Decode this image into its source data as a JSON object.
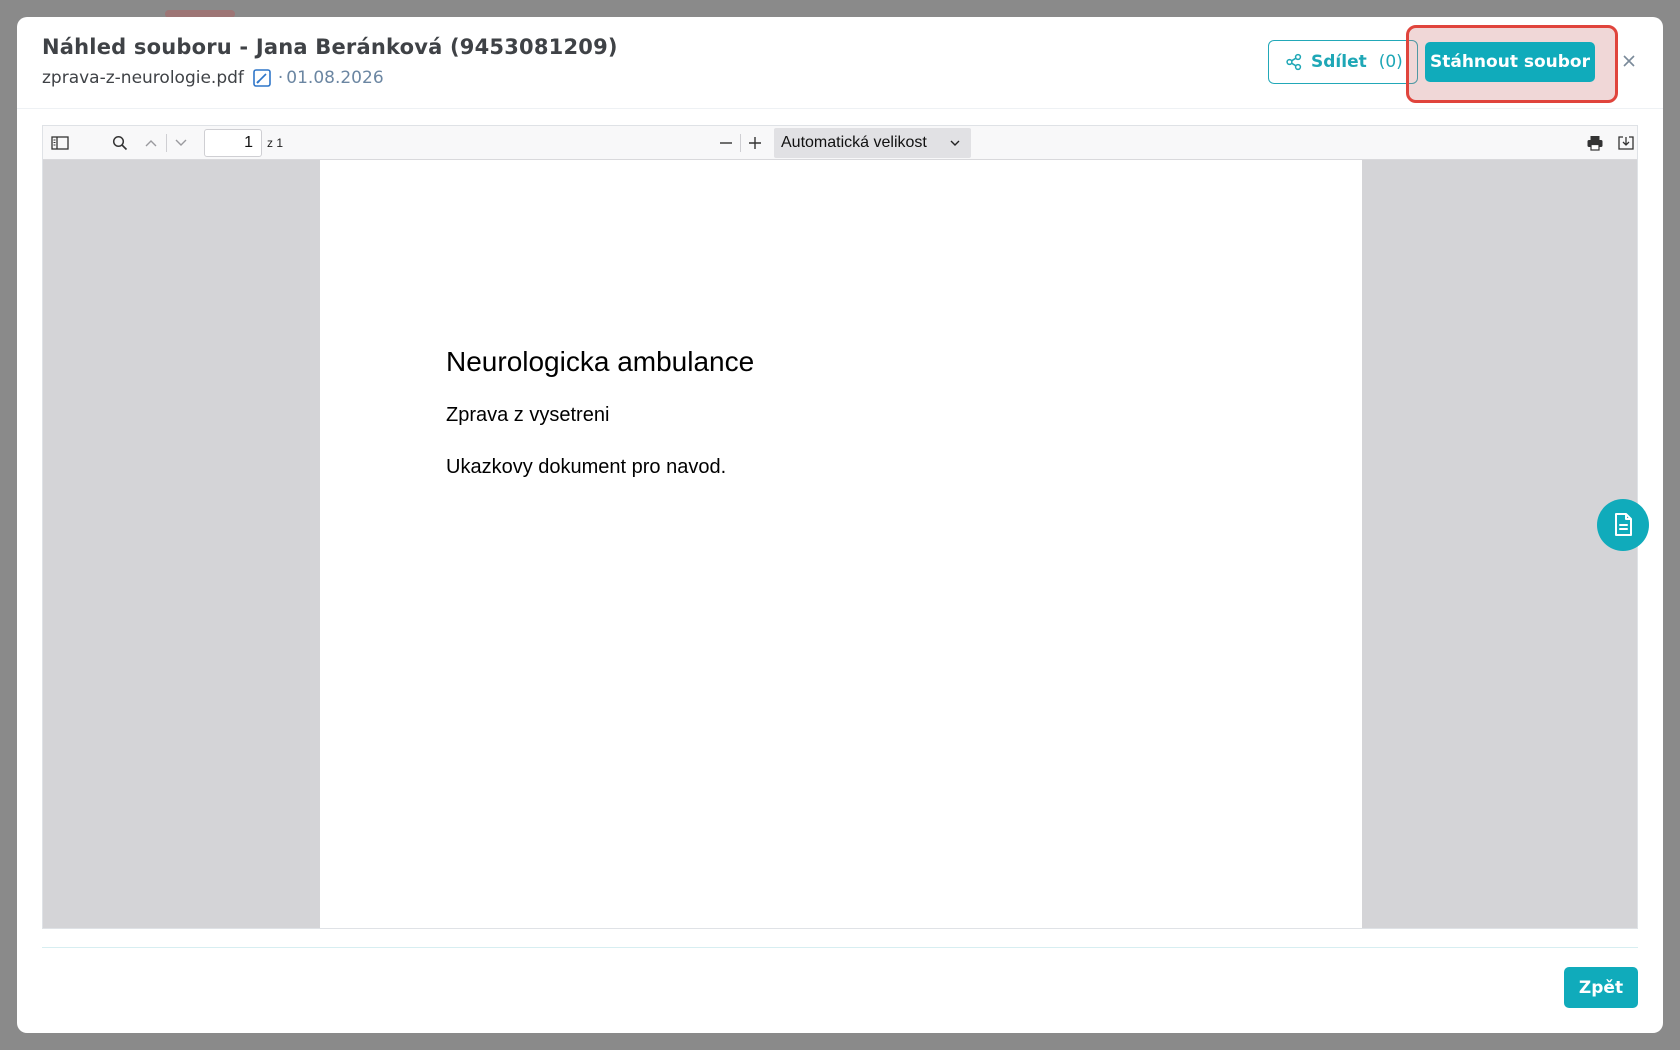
{
  "modal": {
    "title": "Náhled souboru - Jana Beránková (9453081209)",
    "filename": "zprava-z-neurologie.pdf",
    "date_separator": "·",
    "date": "01.08.2026",
    "share_label": "Sdílet",
    "share_count": "(0)",
    "download_label": "Stáhnout soubor",
    "back_label": "Zpět"
  },
  "viewer": {
    "page_number": "1",
    "page_of": "z 1",
    "zoom_label": "Automatická velikost"
  },
  "document": {
    "heading": "Neurologicka ambulance",
    "subheading": "Zprava z vysetreni",
    "body": "Ukazkovy dokument pro navod."
  },
  "colors": {
    "accent": "#10abbb",
    "highlight": "#e0443c"
  },
  "icons": [
    "edit-icon",
    "share-icon",
    "close-icon",
    "sidebar-toggle-icon",
    "search-icon",
    "chevron-up-icon",
    "chevron-down-icon",
    "zoom-out-icon",
    "zoom-in-icon",
    "print-icon",
    "save-icon",
    "document-icon"
  ]
}
